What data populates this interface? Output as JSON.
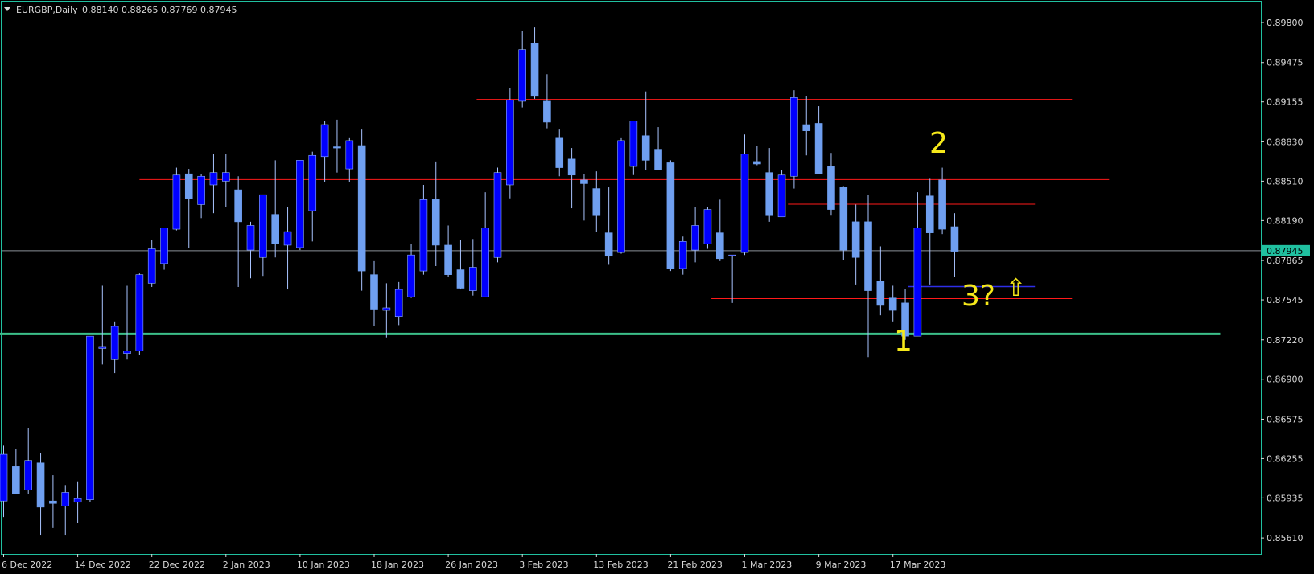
{
  "header": {
    "symbol": "EURGBP,Daily",
    "ohlc": "0.88140 0.88265 0.87769 0.87945"
  },
  "colors": {
    "background": "#000000",
    "bull_fill": "#0000ff",
    "bear_fill": "#6f9ff0",
    "wick": "#a9c4ff",
    "frame": "#20c0a0",
    "resistance": "#ff1a1a",
    "support": "#3cbf8a",
    "current_price": "#8a8f98",
    "price_tag_bg": "#20c0a0",
    "annotation": "#f5e81a",
    "blue_marker": "#2e2ee8"
  },
  "annotations": {
    "wave_1": "1",
    "wave_2": "2",
    "wave_3": "3?",
    "arrow_up": "⇧"
  },
  "chart_data": {
    "type": "candlestick",
    "symbol": "EURGBP",
    "timeframe": "Daily",
    "ylim": [
      0.8548,
      0.8997
    ],
    "y_ticks": [
      "0.89800",
      "0.89475",
      "0.89155",
      "0.88830",
      "0.88510",
      "0.88190",
      "0.87865",
      "0.87545",
      "0.87220",
      "0.86900",
      "0.86575",
      "0.86255",
      "0.85935",
      "0.85610"
    ],
    "x_tick_labels": [
      {
        "index": 0,
        "label": "6 Dec 2022"
      },
      {
        "index": 6,
        "label": "14 Dec 2022"
      },
      {
        "index": 12,
        "label": "22 Dec 2022"
      },
      {
        "index": 18,
        "label": "2 Jan 2023"
      },
      {
        "index": 24,
        "label": "10 Jan 2023"
      },
      {
        "index": 30,
        "label": "18 Jan 2023"
      },
      {
        "index": 36,
        "label": "26 Jan 2023"
      },
      {
        "index": 42,
        "label": "3 Feb 2023"
      },
      {
        "index": 48,
        "label": "13 Feb 2023"
      },
      {
        "index": 54,
        "label": "21 Feb 2023"
      },
      {
        "index": 60,
        "label": "1 Mar 2023"
      },
      {
        "index": 66,
        "label": "9 Mar 2023"
      },
      {
        "index": 72,
        "label": "17 Mar 2023"
      }
    ],
    "last_price": "0.87945",
    "last_price_value": 0.87945,
    "candles": [
      {
        "o": 0.8591,
        "h": 0.8636,
        "l": 0.8578,
        "c": 0.8629
      },
      {
        "o": 0.8619,
        "h": 0.8633,
        "l": 0.8598,
        "c": 0.8597
      },
      {
        "o": 0.86,
        "h": 0.865,
        "l": 0.8597,
        "c": 0.8624
      },
      {
        "o": 0.8622,
        "h": 0.863,
        "l": 0.8563,
        "c": 0.8586
      },
      {
        "o": 0.8591,
        "h": 0.8612,
        "l": 0.8569,
        "c": 0.8589
      },
      {
        "o": 0.8587,
        "h": 0.8604,
        "l": 0.8563,
        "c": 0.8598
      },
      {
        "o": 0.859,
        "h": 0.8607,
        "l": 0.8573,
        "c": 0.8593
      },
      {
        "o": 0.8592,
        "h": 0.8725,
        "l": 0.859,
        "c": 0.8725
      },
      {
        "o": 0.8715,
        "h": 0.8766,
        "l": 0.8702,
        "c": 0.8716
      },
      {
        "o": 0.8706,
        "h": 0.8737,
        "l": 0.8695,
        "c": 0.8733
      },
      {
        "o": 0.8711,
        "h": 0.8766,
        "l": 0.8706,
        "c": 0.8713
      },
      {
        "o": 0.8713,
        "h": 0.8776,
        "l": 0.871,
        "c": 0.8775
      },
      {
        "o": 0.8768,
        "h": 0.8803,
        "l": 0.8765,
        "c": 0.8796
      },
      {
        "o": 0.8784,
        "h": 0.881,
        "l": 0.8779,
        "c": 0.8813
      },
      {
        "o": 0.8812,
        "h": 0.8862,
        "l": 0.8811,
        "c": 0.8856
      },
      {
        "o": 0.8857,
        "h": 0.8861,
        "l": 0.8797,
        "c": 0.8837
      },
      {
        "o": 0.8832,
        "h": 0.8857,
        "l": 0.8821,
        "c": 0.8855
      },
      {
        "o": 0.8848,
        "h": 0.8873,
        "l": 0.8825,
        "c": 0.8858
      },
      {
        "o": 0.8851,
        "h": 0.8873,
        "l": 0.883,
        "c": 0.8858
      },
      {
        "o": 0.8844,
        "h": 0.8855,
        "l": 0.8765,
        "c": 0.8818
      },
      {
        "o": 0.8795,
        "h": 0.8818,
        "l": 0.8772,
        "c": 0.8815
      },
      {
        "o": 0.8789,
        "h": 0.884,
        "l": 0.8774,
        "c": 0.884
      },
      {
        "o": 0.8824,
        "h": 0.8868,
        "l": 0.8789,
        "c": 0.88
      },
      {
        "o": 0.8799,
        "h": 0.883,
        "l": 0.8763,
        "c": 0.881
      },
      {
        "o": 0.8797,
        "h": 0.8866,
        "l": 0.8795,
        "c": 0.8868
      },
      {
        "o": 0.8827,
        "h": 0.8875,
        "l": 0.8802,
        "c": 0.8872
      },
      {
        "o": 0.8871,
        "h": 0.89,
        "l": 0.885,
        "c": 0.8897
      },
      {
        "o": 0.8879,
        "h": 0.8901,
        "l": 0.8858,
        "c": 0.8878
      },
      {
        "o": 0.8861,
        "h": 0.8886,
        "l": 0.885,
        "c": 0.8884
      },
      {
        "o": 0.888,
        "h": 0.8893,
        "l": 0.8762,
        "c": 0.8778
      },
      {
        "o": 0.8775,
        "h": 0.8786,
        "l": 0.8733,
        "c": 0.8747
      },
      {
        "o": 0.8746,
        "h": 0.8768,
        "l": 0.8724,
        "c": 0.8748
      },
      {
        "o": 0.8741,
        "h": 0.8769,
        "l": 0.8734,
        "c": 0.8763
      },
      {
        "o": 0.8757,
        "h": 0.88,
        "l": 0.8756,
        "c": 0.8791
      },
      {
        "o": 0.8778,
        "h": 0.8848,
        "l": 0.8775,
        "c": 0.8836
      },
      {
        "o": 0.8836,
        "h": 0.8867,
        "l": 0.8782,
        "c": 0.8799
      },
      {
        "o": 0.8799,
        "h": 0.8815,
        "l": 0.8773,
        "c": 0.8775
      },
      {
        "o": 0.8779,
        "h": 0.8803,
        "l": 0.8763,
        "c": 0.8764
      },
      {
        "o": 0.8762,
        "h": 0.8804,
        "l": 0.8758,
        "c": 0.8781
      },
      {
        "o": 0.8757,
        "h": 0.8842,
        "l": 0.8759,
        "c": 0.8813
      },
      {
        "o": 0.8789,
        "h": 0.8862,
        "l": 0.8785,
        "c": 0.8858
      },
      {
        "o": 0.8848,
        "h": 0.8927,
        "l": 0.8837,
        "c": 0.8917
      },
      {
        "o": 0.8916,
        "h": 0.8973,
        "l": 0.8911,
        "c": 0.8958
      },
      {
        "o": 0.8963,
        "h": 0.8976,
        "l": 0.8918,
        "c": 0.892
      },
      {
        "o": 0.8916,
        "h": 0.8938,
        "l": 0.8894,
        "c": 0.8899
      },
      {
        "o": 0.8886,
        "h": 0.8893,
        "l": 0.8855,
        "c": 0.8862
      },
      {
        "o": 0.8869,
        "h": 0.8878,
        "l": 0.8829,
        "c": 0.8856
      },
      {
        "o": 0.8852,
        "h": 0.8857,
        "l": 0.8819,
        "c": 0.8849
      },
      {
        "o": 0.8845,
        "h": 0.8859,
        "l": 0.881,
        "c": 0.8823
      },
      {
        "o": 0.8809,
        "h": 0.8846,
        "l": 0.8783,
        "c": 0.879
      },
      {
        "o": 0.8793,
        "h": 0.8886,
        "l": 0.8792,
        "c": 0.8884
      },
      {
        "o": 0.8863,
        "h": 0.89,
        "l": 0.8856,
        "c": 0.89
      },
      {
        "o": 0.8888,
        "h": 0.8924,
        "l": 0.886,
        "c": 0.8868
      },
      {
        "o": 0.8877,
        "h": 0.8895,
        "l": 0.886,
        "c": 0.886
      },
      {
        "o": 0.8866,
        "h": 0.8868,
        "l": 0.8778,
        "c": 0.878
      },
      {
        "o": 0.878,
        "h": 0.8806,
        "l": 0.8775,
        "c": 0.8802
      },
      {
        "o": 0.8795,
        "h": 0.883,
        "l": 0.8785,
        "c": 0.8815
      },
      {
        "o": 0.88,
        "h": 0.883,
        "l": 0.8796,
        "c": 0.8828
      },
      {
        "o": 0.8809,
        "h": 0.8836,
        "l": 0.8786,
        "c": 0.8788
      },
      {
        "o": 0.8791,
        "h": 0.8791,
        "l": 0.8752,
        "c": 0.8791
      },
      {
        "o": 0.8793,
        "h": 0.8889,
        "l": 0.8791,
        "c": 0.8873
      },
      {
        "o": 0.8867,
        "h": 0.888,
        "l": 0.8864,
        "c": 0.8865
      },
      {
        "o": 0.8858,
        "h": 0.8878,
        "l": 0.8818,
        "c": 0.8823
      },
      {
        "o": 0.8822,
        "h": 0.886,
        "l": 0.8823,
        "c": 0.8856
      },
      {
        "o": 0.8855,
        "h": 0.8925,
        "l": 0.8845,
        "c": 0.8919
      },
      {
        "o": 0.8897,
        "h": 0.892,
        "l": 0.8872,
        "c": 0.8892
      },
      {
        "o": 0.8898,
        "h": 0.8912,
        "l": 0.8857,
        "c": 0.8857
      },
      {
        "o": 0.8863,
        "h": 0.8874,
        "l": 0.8823,
        "c": 0.8828
      },
      {
        "o": 0.8846,
        "h": 0.8847,
        "l": 0.8787,
        "c": 0.8795
      },
      {
        "o": 0.8818,
        "h": 0.8832,
        "l": 0.8767,
        "c": 0.8789
      },
      {
        "o": 0.8818,
        "h": 0.884,
        "l": 0.8708,
        "c": 0.8762
      },
      {
        "o": 0.877,
        "h": 0.8798,
        "l": 0.8742,
        "c": 0.875
      },
      {
        "o": 0.8756,
        "h": 0.8766,
        "l": 0.8737,
        "c": 0.8746
      },
      {
        "o": 0.8752,
        "h": 0.8763,
        "l": 0.8722,
        "c": 0.8725
      },
      {
        "o": 0.8725,
        "h": 0.8842,
        "l": 0.8725,
        "c": 0.8813
      },
      {
        "o": 0.8839,
        "h": 0.8853,
        "l": 0.8767,
        "c": 0.8809
      },
      {
        "o": 0.8852,
        "h": 0.8862,
        "l": 0.8808,
        "c": 0.8812
      },
      {
        "o": 0.8814,
        "h": 0.8825,
        "l": 0.8773,
        "c": 0.8794
      }
    ],
    "hlines": [
      {
        "name": "resistance-top",
        "y": 0.89175,
        "from": 38.3,
        "to": 86.5,
        "color": "#ff1a1a"
      },
      {
        "name": "resistance-mid",
        "y": 0.88523,
        "from": 11,
        "to": 89.5,
        "color": "#ff1a1a"
      },
      {
        "name": "resistance-inner",
        "y": 0.88323,
        "from": 63.5,
        "to": 83.5,
        "color": "#ff1a1a"
      },
      {
        "name": "support-low",
        "y": 0.87555,
        "from": 57.3,
        "to": 86.5,
        "color": "#ff1a1a"
      },
      {
        "name": "support-main",
        "y": 0.87268,
        "from": -0.5,
        "to": 98.5,
        "color": "#3cbf8a",
        "width": 3
      }
    ],
    "blue_segment": {
      "y": 0.87653,
      "from": 73.2,
      "to": 83.5,
      "color": "#2e2ee8"
    }
  }
}
